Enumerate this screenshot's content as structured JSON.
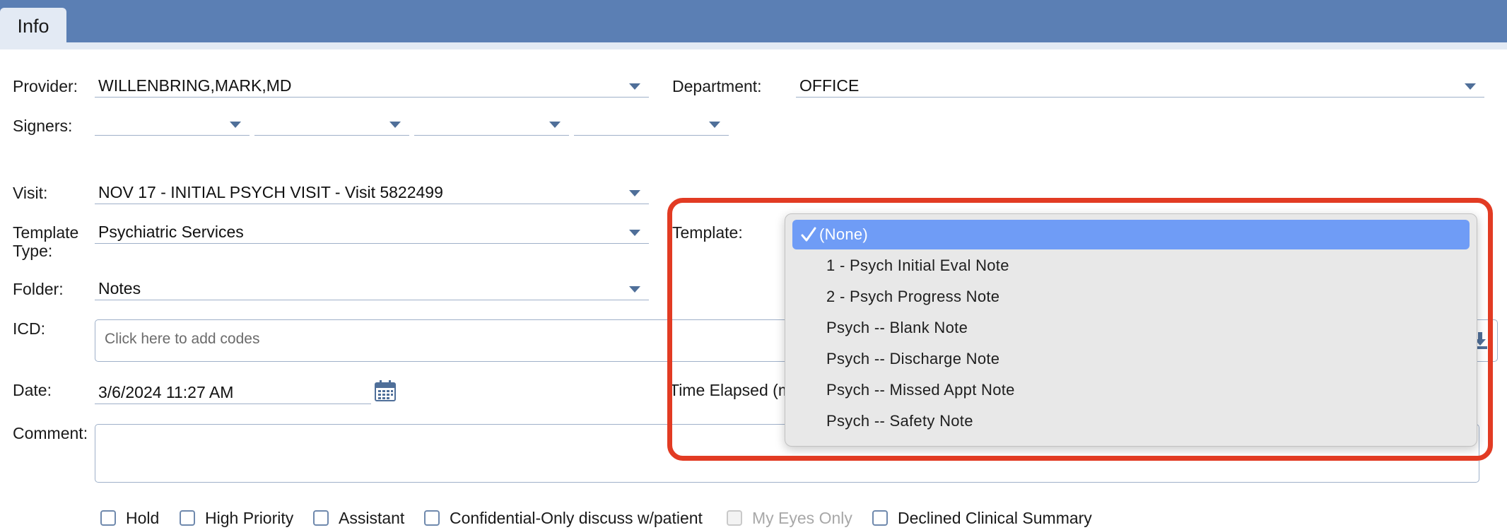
{
  "tab": {
    "label": "Info"
  },
  "provider": {
    "label": "Provider:",
    "value": "WILLENBRING,MARK,MD"
  },
  "department": {
    "label": "Department:",
    "value": "OFFICE"
  },
  "signers": {
    "label": "Signers:"
  },
  "visit": {
    "label": "Visit:",
    "value": "NOV 17 - INITIAL PSYCH VISIT - Visit 5822499"
  },
  "template_type": {
    "label_line1": "Template",
    "label_line2": "Type:",
    "value": "Psychiatric Services"
  },
  "template": {
    "label": "Template:",
    "options": [
      "(None)",
      "1 - Psych Initial Eval Note",
      "2 - Psych Progress Note",
      "Psych -- Blank Note",
      "Psych -- Discharge Note",
      "Psych -- Missed Appt Note",
      "Psych -- Safety Note"
    ],
    "selected_index": 0
  },
  "folder": {
    "label": "Folder:",
    "value": "Notes"
  },
  "icd": {
    "label": "ICD:",
    "placeholder": "Click here to add codes"
  },
  "date": {
    "label": "Date:",
    "value": "3/6/2024 11:27 AM"
  },
  "time_elapsed": {
    "label": "Time Elapsed (m"
  },
  "comment": {
    "label": "Comment:"
  },
  "checkboxes": [
    {
      "label": "Hold",
      "disabled": false
    },
    {
      "label": "High Priority",
      "disabled": false
    },
    {
      "label": "Assistant",
      "disabled": false
    },
    {
      "label": "Confidential-Only discuss w/patient",
      "disabled": false
    },
    {
      "label": "My Eyes Only",
      "disabled": true
    },
    {
      "label": "Declined Clinical Summary",
      "disabled": false
    }
  ],
  "colors": {
    "header": "#5b7fb4",
    "highlight": "#e23b23",
    "selected": "#6f9cf6"
  },
  "icons": {
    "calendar": "calendar-icon",
    "caret": "chevron-down-icon",
    "check": "checkmark-icon"
  }
}
